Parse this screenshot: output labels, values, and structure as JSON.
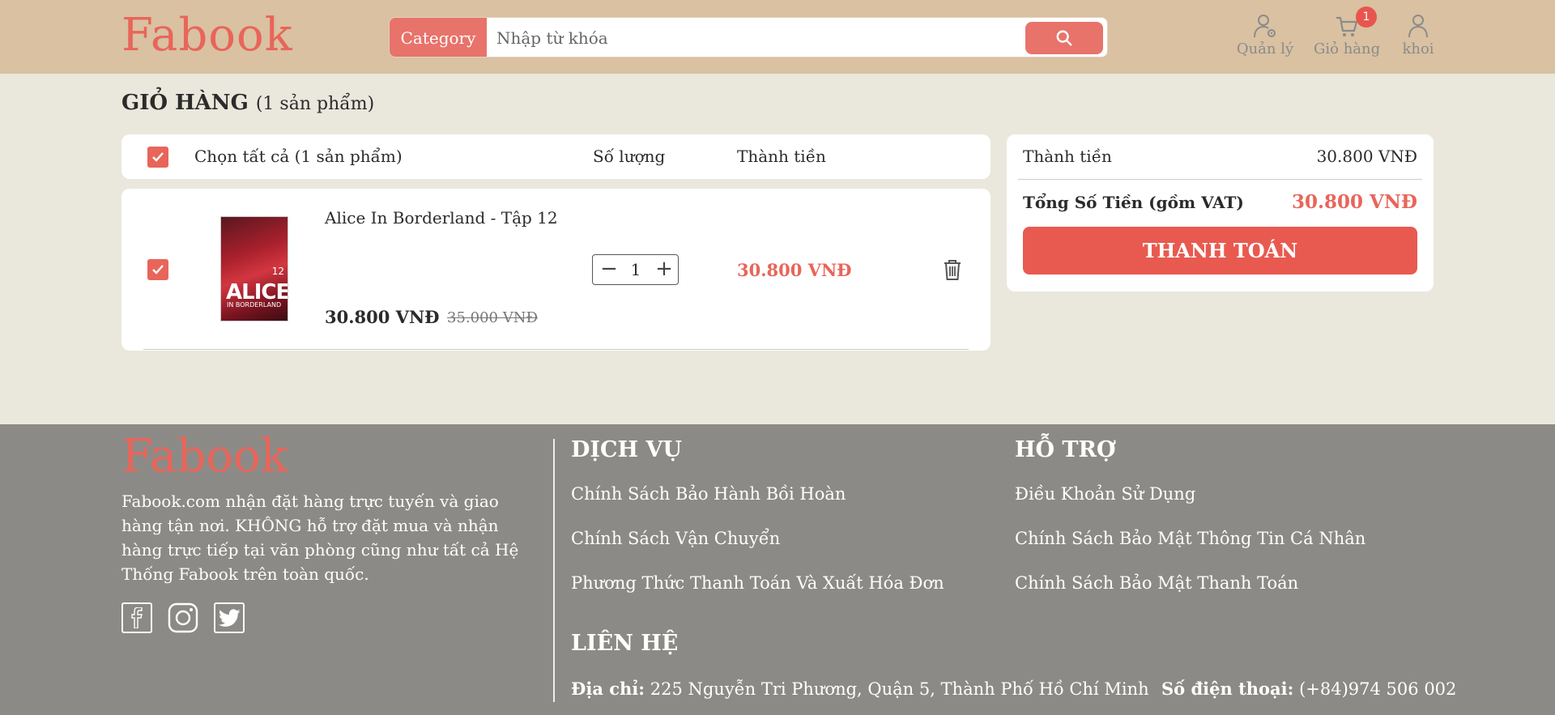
{
  "header": {
    "logo": "Fabook",
    "category_label": "Category",
    "search_placeholder": "Nhập từ khóa",
    "nav": {
      "manage_label": "Quản lý",
      "cart_label": "Giỏ hàng",
      "cart_badge": "1",
      "user_label": "khoi"
    }
  },
  "cart": {
    "title": "GIỎ HÀNG",
    "count_text": "(1 sản phẩm)",
    "select_all_label": "Chọn tất cả (1 sản phẩm)",
    "col_quantity": "Số lượng",
    "col_total": "Thành tiền",
    "items": [
      {
        "name": "Alice In Borderland - Tập 12",
        "price": "30.800 VNĐ",
        "old_price": "35.000 VNĐ",
        "quantity": "1",
        "line_total": "30.800 VNĐ",
        "cover_text": "ALICE",
        "cover_subtext": "IN BORDERLAND",
        "cover_volume": "12"
      }
    ]
  },
  "summary": {
    "subtotal_label": "Thành tiền",
    "subtotal_value": "30.800 VNĐ",
    "total_label": "Tổng Số Tiền (gồm VAT)",
    "total_value": "30.800 VNĐ",
    "checkout_label": "THANH TOÁN"
  },
  "footer": {
    "logo": "Fabook",
    "description": "Fabook.com nhận đặt hàng trực tuyến và giao hàng tận nơi. KHÔNG hỗ trợ đặt mua và nhận hàng trực tiếp tại văn phòng cũng như tất cả Hệ Thống Fabook trên toàn quốc.",
    "services_title": "DỊCH VỤ",
    "services": [
      "Chính Sách Bảo Hành Bồi Hoàn",
      "Chính Sách Vận Chuyển",
      "Phương Thức Thanh Toán Và Xuất Hóa Đơn"
    ],
    "support_title": "HỖ TRỢ",
    "support": [
      "Điều Khoản Sử Dụng",
      "Chính Sách Bảo Mật Thông Tin Cá Nhân",
      "Chính Sách Bảo Mật Thanh Toán"
    ],
    "contact_title": "LIÊN HỆ",
    "address_label": "Địa chỉ:",
    "address": "225 Nguyễn Tri Phương, Quận 5, Thành Phố Hồ Chí Minh",
    "phone_label": "Số điện thoại:",
    "phone": "(+84)974 506 002"
  },
  "colors": {
    "header_bg": "#d9c1a1",
    "page_bg": "#eae7dc",
    "accent": "#e8655a",
    "footer_bg": "#8c8a86"
  }
}
